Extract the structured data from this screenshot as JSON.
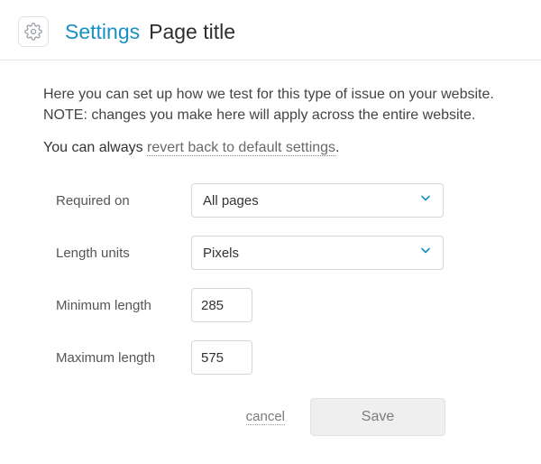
{
  "header": {
    "settings_label": "Settings",
    "page_title": "Page title"
  },
  "description": "Here you can set up how we test for this type of issue on your website. NOTE: changes you make here will apply across the entire website.",
  "revert": {
    "prefix": "You can always ",
    "link": "revert back to default settings",
    "suffix": "."
  },
  "form": {
    "required_on": {
      "label": "Required on",
      "value": "All pages"
    },
    "length_units": {
      "label": "Length units",
      "value": "Pixels"
    },
    "min_length": {
      "label": "Minimum length",
      "value": "285"
    },
    "max_length": {
      "label": "Maximum length",
      "value": "575"
    }
  },
  "actions": {
    "cancel": "cancel",
    "save": "Save"
  }
}
